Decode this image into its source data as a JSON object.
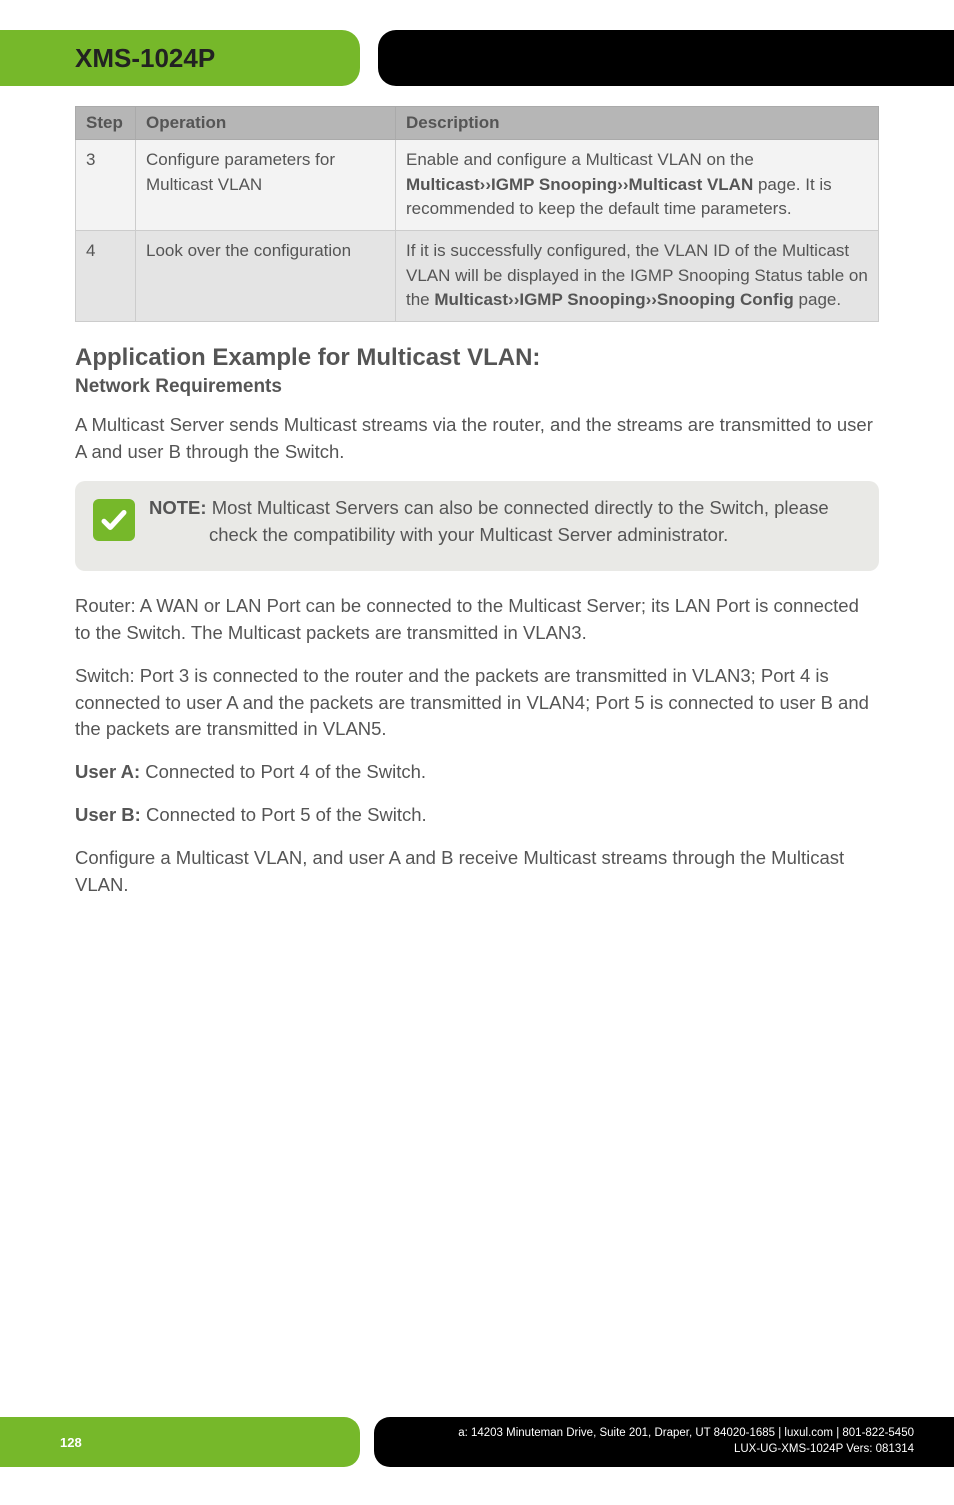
{
  "header": {
    "model": "XMS-1024P"
  },
  "table": {
    "headers": {
      "step": "Step",
      "operation": "Operation",
      "description": "Description"
    },
    "rows": [
      {
        "step": "3",
        "operation": "Configure parameters for Multicast VLAN",
        "desc_pre": "Enable and configure a Multicast VLAN on the ",
        "desc_bold": "Multicast››IGMP Snooping››Multicast VLAN",
        "desc_post": " page. It is recommended to keep the default time parameters."
      },
      {
        "step": "4",
        "operation": "Look over the configuration",
        "desc_pre": "If it is successfully configured, the VLAN ID of the Multicast VLAN will be displayed in the IGMP Snooping Status table on the ",
        "desc_bold1": "Multicast››IGMP Snooping››Snooping Config",
        "desc_post": " page."
      }
    ]
  },
  "section": {
    "title": "Application Example for Multicast VLAN:",
    "subtitle": "Network Requirements",
    "p1": "A Multicast Server sends Multicast streams via the router, and the streams are transmitted to user A and user B through the Switch.",
    "note_label": "NOTE:",
    "note_body": " Most Multicast Servers can also be connected directly to the Switch, please check the compatibility with your Multicast Server administrator.",
    "p_router": "Router: A WAN or LAN Port can be connected to the Multicast Server; its LAN Port is connected to the Switch. The Multicast packets are transmitted in VLAN3.",
    "p_switch": "Switch: Port 3 is connected to the router and the packets are transmitted in VLAN3; Port 4 is connected to user A and the packets are transmitted in VLAN4; Port 5 is connected to user B and the packets are transmitted in VLAN5.",
    "userA_label": "User A:",
    "userA_text": " Connected to Port 4 of the Switch.",
    "userB_label": "User B:",
    "userB_text": " Connected to Port 5 of the Switch.",
    "p_config": "Configure a Multicast VLAN, and user A and B receive Multicast streams through the Multicast VLAN."
  },
  "footer": {
    "page": "128",
    "line1": "a: 14203 Minuteman Drive, Suite 201, Draper, UT 84020-1685 | luxul.com | 801-822-5450",
    "line2": "LUX-UG-XMS-1024P  Vers: 081314"
  }
}
